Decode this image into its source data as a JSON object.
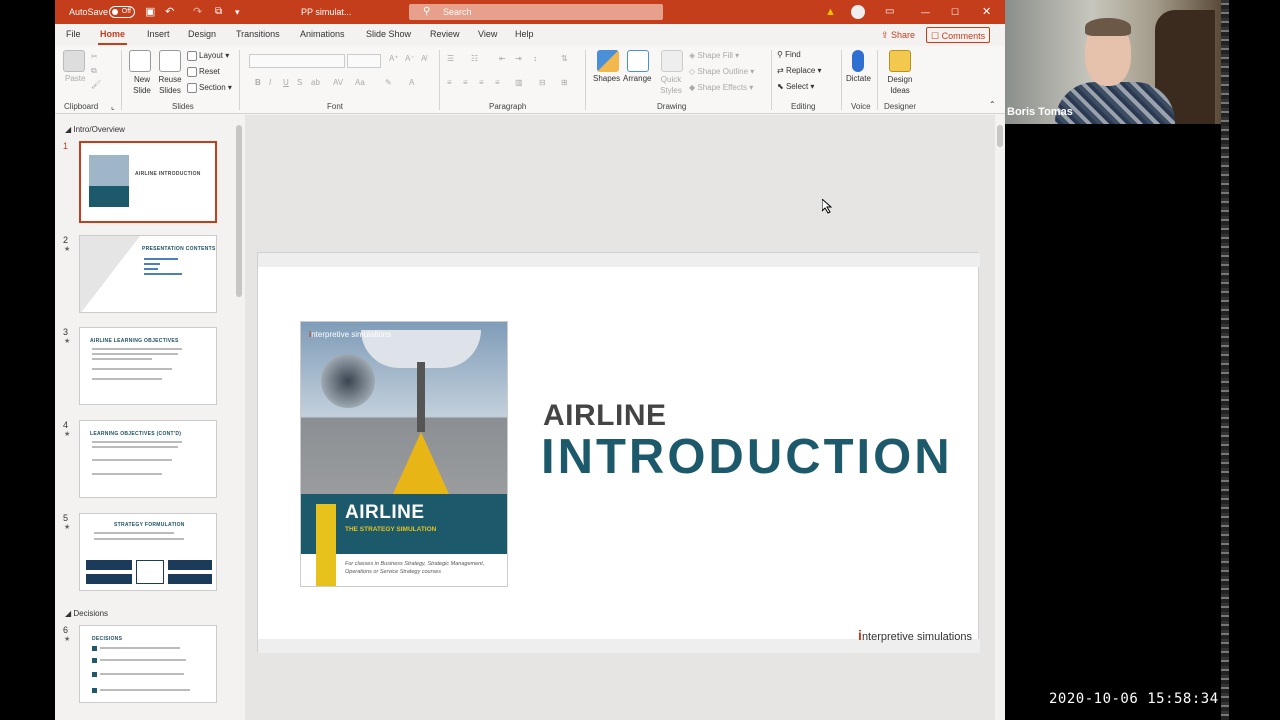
{
  "titlebar": {
    "autosave_label": "AutoSave",
    "autosave_state": "Off",
    "doc_title": "PP simulat...",
    "search_placeholder": "Search"
  },
  "tabs": [
    "File",
    "Home",
    "Insert",
    "Design",
    "Transitions",
    "Animations",
    "Slide Show",
    "Review",
    "View",
    "Help"
  ],
  "active_tab": "Home",
  "share_label": "Share",
  "comments_label": "Comments",
  "ribbon": {
    "clipboard": {
      "paste": "Paste",
      "group": "Clipboard"
    },
    "slides": {
      "new_slide": "New Slide",
      "reuse_slides": "Reuse Slides",
      "layout": "Layout",
      "reset": "Reset",
      "section": "Section",
      "group": "Slides"
    },
    "font": {
      "group": "Font"
    },
    "paragraph": {
      "group": "Paragraph"
    },
    "drawing": {
      "shapes": "Shapes",
      "arrange": "Arrange",
      "quick_styles": "Quick Styles",
      "shape_fill": "Shape Fill",
      "shape_outline": "Shape Outline",
      "shape_effects": "Shape Effects",
      "group": "Drawing"
    },
    "editing": {
      "find": "Find",
      "replace": "Replace",
      "select": "Select",
      "group": "Editing"
    },
    "voice": {
      "dictate": "Dictate",
      "group": "Voice"
    },
    "designer": {
      "design_ideas": "Design Ideas",
      "group": "Designer"
    }
  },
  "sections": [
    {
      "name": "Intro/Overview"
    },
    {
      "name": "Decisions"
    }
  ],
  "thumbnails": [
    {
      "num": "1",
      "title": "AIRLINE INTRODUCTION"
    },
    {
      "num": "2",
      "title": "PRESENTATION CONTENTS"
    },
    {
      "num": "3",
      "title": "AIRLINE LEARNING OBJECTIVES"
    },
    {
      "num": "4",
      "title": "LEARNING OBJECTIVES (CONT'D)"
    },
    {
      "num": "5",
      "title": "STRATEGY FORMULATION"
    },
    {
      "num": "6",
      "title": "DECISIONS"
    }
  ],
  "slide": {
    "title_line1": "AIRLINE",
    "title_line2": "INTRODUCTION",
    "logo_text": "nterpretive simulations",
    "logo_initial": "i",
    "cover": {
      "brand_initial": "i",
      "brand": "nterpretive simulations",
      "title": "AIRLINE",
      "subtitle": "THE STRATEGY SIMULATION",
      "note": "For classes in Business Strategy, Strategic Management, Operations or Service Strategy courses"
    }
  },
  "webcam": {
    "name": "Boris Tomas"
  },
  "timestamp": "2020-10-06  15:58:34",
  "colors": {
    "accent": "#c43e1c",
    "teal": "#1c5a6b",
    "yellow": "#e8c21c"
  }
}
